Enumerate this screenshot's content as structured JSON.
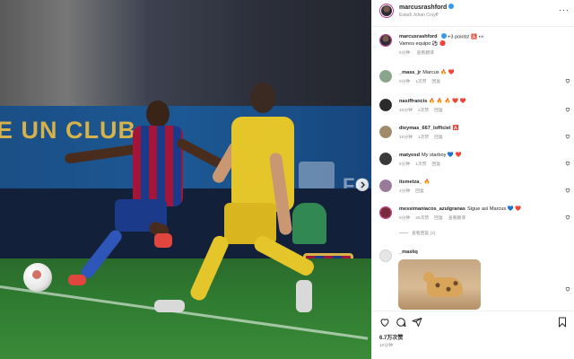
{
  "post": {
    "author": "marcusrashford",
    "location": "Estadi Johan Cruyff",
    "more_label": "···"
  },
  "photo": {
    "banner_text": "E UN CLUB",
    "banner_text_right": "FC"
  },
  "caption": {
    "username": "marcusrashford",
    "text": "+3 points! 🅰️ 👀",
    "text2": "Vamos equipo ⚽ 🔴",
    "time": "5分钟",
    "translate": "查看翻译"
  },
  "comments": [
    {
      "username": "_mass_jr",
      "text": "Marcus 🔥 ❤️",
      "time": "5分钟",
      "likes": "1次赞",
      "reply": "回复"
    },
    {
      "username": "nasiffrancis",
      "text": "🔥 🔥 🔥 ❤️ ❤️",
      "time": "10分钟",
      "likes": "2次赞",
      "reply": "回复"
    },
    {
      "username": "dieymas_667_lofficiel",
      "text": "🅰️",
      "time": "10分钟",
      "likes": "1次赞",
      "reply": "回复"
    },
    {
      "username": "matyosd",
      "text": "My starboy 💙 ❤️",
      "time": "5分钟",
      "likes": "1次赞",
      "reply": "回复"
    },
    {
      "username": "itsmetza_",
      "text": "🔥",
      "time": "4分钟",
      "reply": "回复"
    },
    {
      "username": "messimaniacos_azulgranas",
      "text": "Sigue así Marcus 💙 ❤️",
      "time": "5分钟",
      "likes": "25次赞",
      "reply": "回复",
      "translate": "查看翻译",
      "view_replies": "查看回复 (2)"
    },
    {
      "username": "_masliq",
      "text": ""
    }
  ],
  "footer": {
    "likes": "6.7万次赞",
    "posted": "10分钟"
  },
  "colors": {
    "verified": "#3897f0",
    "heart_like": "#ed4956",
    "muted_text": "#8e8e8e"
  },
  "icons": {
    "like": "heart-icon",
    "comment": "comment-icon",
    "share": "share-icon",
    "save": "bookmark-icon",
    "next": "chevron-right-icon"
  }
}
